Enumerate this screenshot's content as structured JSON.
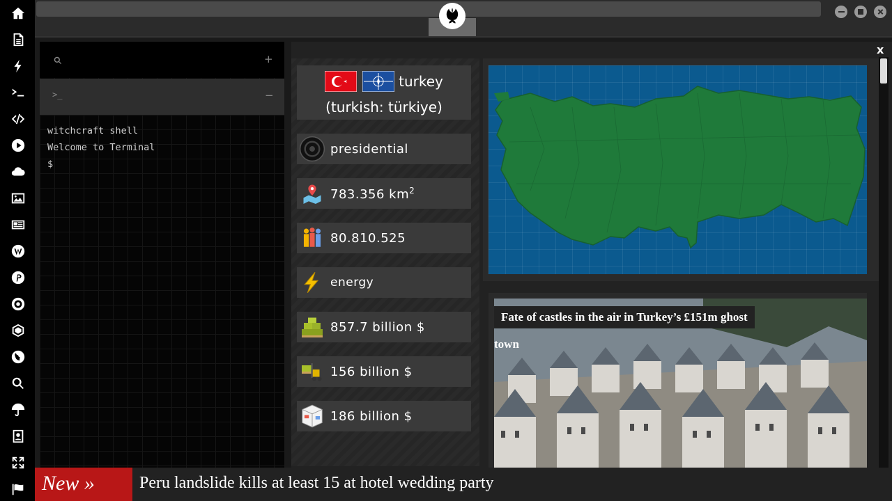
{
  "sidebar": {
    "items": [
      {
        "icon": "home-icon"
      },
      {
        "icon": "document-icon"
      },
      {
        "icon": "lightning-icon"
      },
      {
        "icon": "terminal-icon"
      },
      {
        "icon": "code-icon"
      },
      {
        "icon": "play-icon"
      },
      {
        "icon": "cloud-icon"
      },
      {
        "icon": "image-icon"
      },
      {
        "icon": "newspaper-icon"
      },
      {
        "icon": "wordpress-icon"
      },
      {
        "icon": "pinterest-icon"
      },
      {
        "icon": "galactic-empire-icon"
      },
      {
        "icon": "network-icon"
      },
      {
        "icon": "globe-icon"
      },
      {
        "icon": "search-icon"
      },
      {
        "icon": "umbrella-icon"
      },
      {
        "icon": "contacts-icon"
      },
      {
        "icon": "expand-icon"
      },
      {
        "icon": "flag-icon"
      }
    ]
  },
  "terminal": {
    "search_placeholder": "",
    "add_label": "+",
    "tab_prompt": ">_",
    "tab_minus": "−",
    "lines": [
      "witchcraft shell",
      "Welcome to Terminal",
      "$"
    ]
  },
  "country": {
    "name": "turkey",
    "native": "(turkish: türkiye)",
    "government": "presidential",
    "area": "783.356 km",
    "area_sup": "2",
    "population": "80.810.525",
    "sector": "energy",
    "gdp": "857.7 billion $",
    "imports": "156 billion $",
    "exports": "186 billion $"
  },
  "main": {
    "close_label": "x"
  },
  "news": {
    "headline_line1": "Fate of castles in the air in Turkey’s £151m ghost",
    "headline_line2": "town"
  },
  "ticker": {
    "label": "New »",
    "text": "Peru landslide kills at least 15 at hotel wedding party"
  },
  "colors": {
    "accent_red": "#b81717",
    "map_sea": "#0b5a8f",
    "map_land": "#1f7a3a"
  }
}
